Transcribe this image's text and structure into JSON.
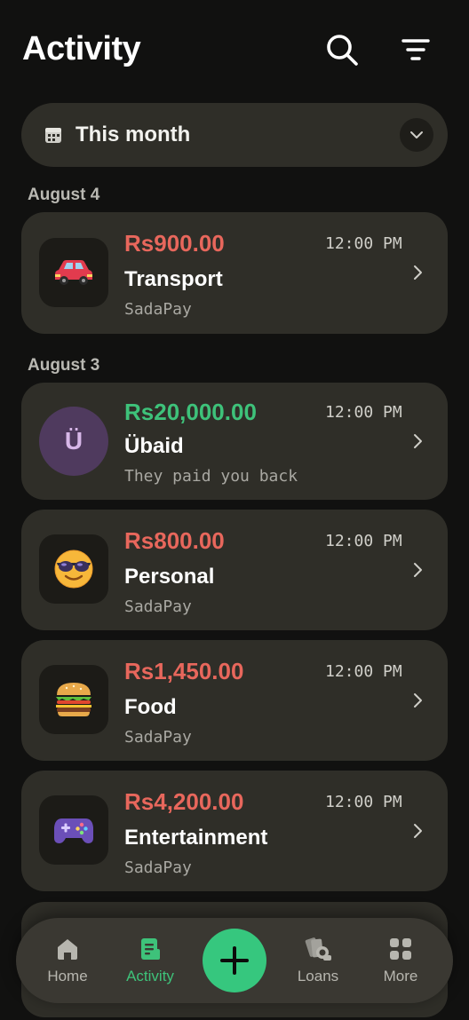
{
  "header": {
    "title": "Activity"
  },
  "period": {
    "label": "This month"
  },
  "groups": [
    {
      "date": "August 4"
    },
    {
      "date": "August 3"
    }
  ],
  "transactions": [
    {
      "amount": "Rs900.00",
      "time": "12:00 PM",
      "name": "Transport",
      "sub": "SadaPay",
      "icon": "car-icon",
      "type": "debit"
    },
    {
      "amount": "Rs20,000.00",
      "time": "12:00 PM",
      "name": "Übaid",
      "sub": "They paid you back",
      "initial": "Ü",
      "type": "credit"
    },
    {
      "amount": "Rs800.00",
      "time": "12:00 PM",
      "name": "Personal",
      "sub": "SadaPay",
      "icon": "sunglasses-face-icon",
      "type": "debit"
    },
    {
      "amount": "Rs1,450.00",
      "time": "12:00 PM",
      "name": "Food",
      "sub": "SadaPay",
      "icon": "burger-icon",
      "type": "debit"
    },
    {
      "amount": "Rs4,200.00",
      "time": "12:00 PM",
      "name": "Entertainment",
      "sub": "SadaPay",
      "icon": "game-controller-icon",
      "type": "debit"
    }
  ],
  "nav": {
    "home": "Home",
    "activity": "Activity",
    "loans": "Loans",
    "more": "More",
    "active": "activity"
  },
  "colors": {
    "background": "#111110",
    "card": "#2f2e28",
    "debit": "#e8675c",
    "credit": "#3ec27a",
    "accent": "#36c77e"
  }
}
